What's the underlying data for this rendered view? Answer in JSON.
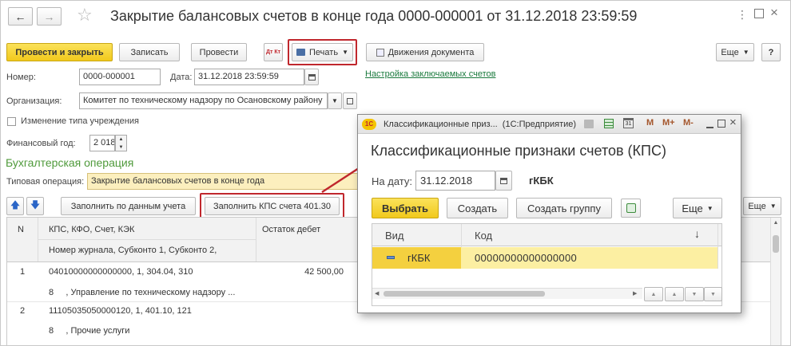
{
  "window": {
    "title": "Закрытие балансовых счетов в конце года 0000-000001 от 31.12.2018 23:59:59"
  },
  "toolbar": {
    "post_close": "Провести и закрыть",
    "save": "Записать",
    "post": "Провести",
    "dt_kt": "Дт Кт",
    "print": "Печать",
    "movements": "Движения документа",
    "more": "Еще",
    "help": "?"
  },
  "form": {
    "number_label": "Номер:",
    "number_value": "0000-000001",
    "date_label": "Дата:",
    "date_value": "31.12.2018 23:59:59",
    "settings_link": "Настройка заключаемых счетов",
    "org_label": "Организация:",
    "org_value": "Комитет по техническому надзору по Осановскому району",
    "change_type_label": "Изменение типа учреждения",
    "fin_year_label": "Финансовый год:",
    "fin_year_value": "2 018",
    "section_title": "Бухгалтерская операция",
    "typical_op_label": "Типовая операция:",
    "typical_op_value": "Закрытие балансовых счетов в конце года"
  },
  "table_toolbar": {
    "fill_by_data": "Заполнить по данным учета",
    "fill_kps": "Заполнить КПС счета 401.30",
    "more": "Еще"
  },
  "table": {
    "col_n": "N",
    "col_kps": "КПС, КФО, Счет, КЭК",
    "col_kps_sub": "Номер журнала, Субконто 1, Субконто 2,",
    "col_balance": "Остаток дебет",
    "rows": [
      {
        "n": "1",
        "kps": "04010000000000000, 1, 304.04, 310",
        "sub": "8     , Управление по техническому надзору ...",
        "balance": "42 500,00"
      },
      {
        "n": "2",
        "kps": "11105035050000120, 1, 401.10, 121",
        "sub": "8     , Прочие услуги",
        "balance": ""
      }
    ]
  },
  "dialog": {
    "app_title": "Классификационные приз...  (1С:Предприятие)",
    "title": "Классификационные признаки счетов (КПС)",
    "date_label": "На дату:",
    "date_value": "31.12.2018",
    "kind_value": "гКБК",
    "select": "Выбрать",
    "create": "Создать",
    "create_group": "Создать группу",
    "more": "Еще",
    "col_kind": "Вид",
    "col_code": "Код",
    "sort_arrow": "↓",
    "row_kind": "гКБК",
    "row_code": "00000000000000000",
    "m_buttons": [
      "M",
      "M+",
      "M-"
    ]
  }
}
